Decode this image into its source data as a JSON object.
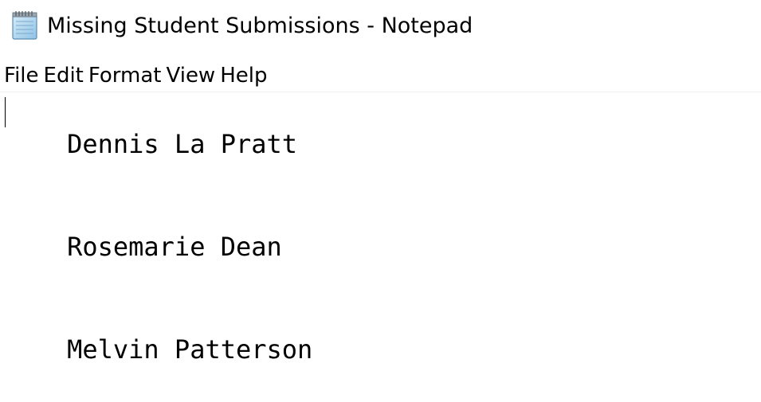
{
  "window": {
    "title": "Missing Student Submissions - Notepad",
    "icon": "notepad-icon"
  },
  "menu": {
    "items": [
      {
        "label": "File"
      },
      {
        "label": "Edit"
      },
      {
        "label": "Format"
      },
      {
        "label": "View"
      },
      {
        "label": "Help"
      }
    ]
  },
  "editor": {
    "lines": [
      "Dennis La Pratt",
      "Rosemarie Dean",
      "Melvin Patterson"
    ]
  }
}
